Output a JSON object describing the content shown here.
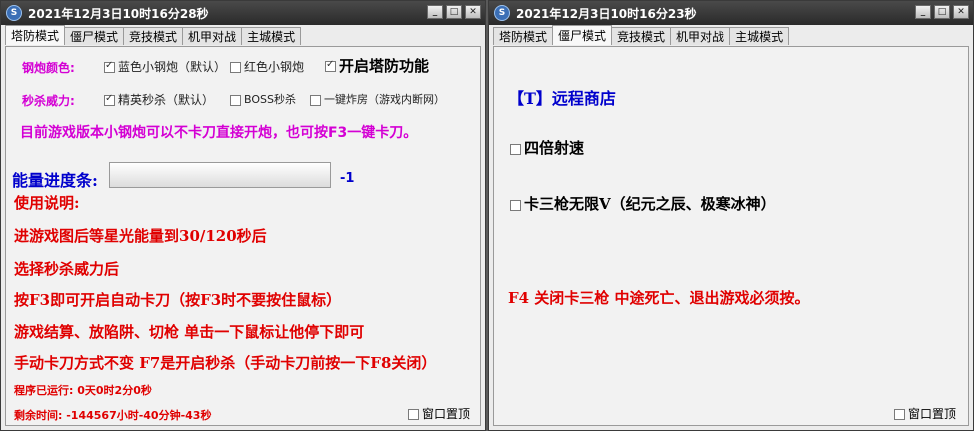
{
  "left_window": {
    "title": "2021年12月3日10时16分28秒",
    "tabs": [
      "塔防模式",
      "僵尸模式",
      "竞技模式",
      "机甲对战",
      "主城模式"
    ],
    "active_tab": "塔防模式",
    "cannon_color": {
      "label": "钢炮颜色:",
      "options": [
        {
          "label": "蓝色小钢炮（默认）",
          "checked": true
        },
        {
          "label": "红色小钢炮",
          "checked": false
        }
      ]
    },
    "tower_defense_toggle": {
      "label": "开启塔防功能",
      "checked": true
    },
    "kill_power": {
      "label": "秒杀威力:",
      "options": [
        {
          "label": "精英秒杀（默认）",
          "checked": true
        },
        {
          "label": "BOSS秒杀",
          "checked": false
        },
        {
          "label": "一键炸房（游戏内断网）",
          "checked": false
        }
      ]
    },
    "notice": "目前游戏版本小钢炮可以不卡刀直接开炮，也可按F3一键卡刀。",
    "energy": {
      "label": "能量进度条:",
      "value": "-1"
    },
    "instructions_title": "使用说明:",
    "instructions": [
      "进游戏图后等星光能量到30/120秒后",
      "选择秒杀威力后",
      "按F3即可开启自动卡刀（按F3时不要按住鼠标）",
      "游戏结算、放陷阱、切枪 单击一下鼠标让他停下即可",
      "手动卡刀方式不变 F7是开启秒杀（手动卡刀前按一下F8关闭）"
    ],
    "runtime": "程序已运行: 0天0时2分0秒",
    "remaining": "剩余时间:  -144567小时-40分钟-43秒",
    "pin_window": {
      "label": "窗口置顶",
      "checked": false
    }
  },
  "right_window": {
    "title": "2021年12月3日10时16分23秒",
    "tabs": [
      "塔防模式",
      "僵尸模式",
      "竞技模式",
      "机甲对战",
      "主城模式"
    ],
    "active_tab": "僵尸模式",
    "shop_link": "【T】远程商店",
    "options": [
      {
        "label": "四倍射速",
        "checked": false
      },
      {
        "label": "卡三枪无限V（纪元之辰、极寒冰神）",
        "checked": false
      }
    ],
    "f4_note": "F4 关闭卡三枪 中途死亡、退出游戏必须按。",
    "pin_window": {
      "label": "窗口置顶",
      "checked": false
    }
  },
  "icons": {
    "app": "s-logo-icon",
    "minimize": "minimize-icon",
    "maximize": "maximize-icon",
    "close": "close-icon"
  },
  "colors": {
    "magenta": "#d400d4",
    "red": "#e00000",
    "blue": "#0000cc",
    "titlebar": "#2a2a2a"
  }
}
